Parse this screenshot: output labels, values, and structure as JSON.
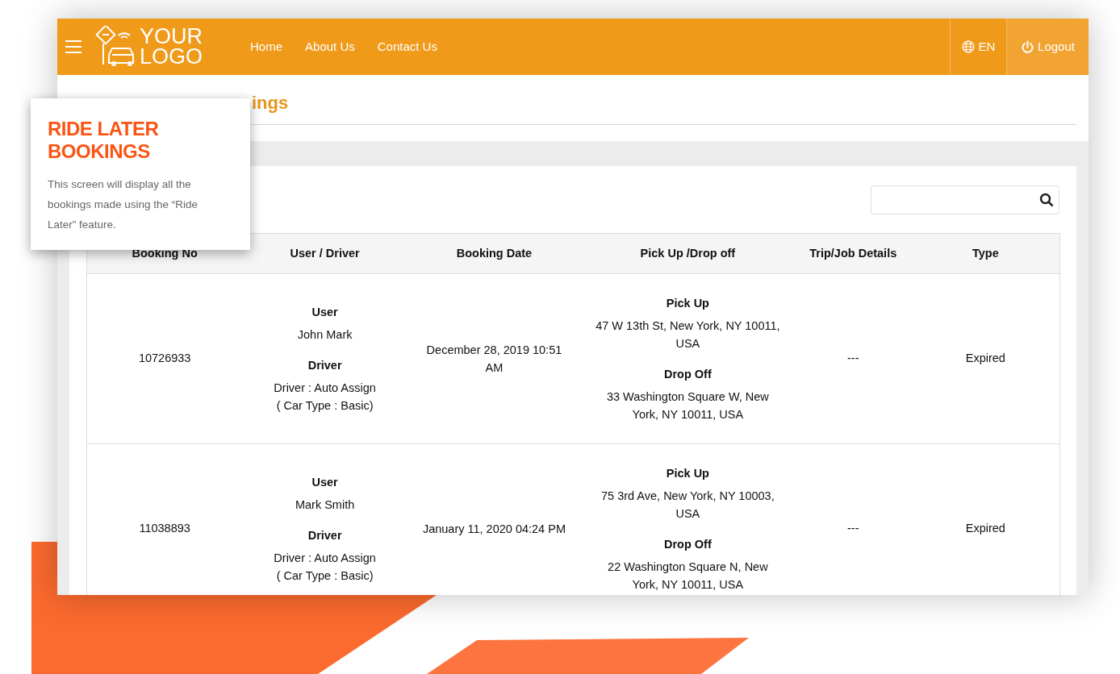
{
  "header": {
    "logo": {
      "line1": "YOUR",
      "line2": "LOGO"
    },
    "nav": [
      {
        "label": "Home"
      },
      {
        "label": "About Us"
      },
      {
        "label": "Contact Us"
      }
    ],
    "language": "EN",
    "logout": "Logout"
  },
  "page_title": "ings",
  "table": {
    "columns": [
      "Booking No",
      "User / Driver",
      "Booking Date",
      "Pick Up /Drop off",
      "Trip/Job Details",
      "Type"
    ],
    "rows": [
      {
        "booking_no": "10726933",
        "user_label": "User",
        "user": "John Mark",
        "driver_label": "Driver",
        "driver": "Driver : Auto Assign",
        "car_type": "( Car Type : Basic)",
        "date": "December 28, 2019 10:51 AM",
        "pickup_label": "Pick Up",
        "pickup": "47 W 13th St, New York, NY 10011, USA",
        "dropoff_label": "Drop Off",
        "dropoff": "33 Washington Square W, New York, NY 10011, USA",
        "details": "---",
        "type": "Expired"
      },
      {
        "booking_no": "11038893",
        "user_label": "User",
        "user": "Mark Smith",
        "driver_label": "Driver",
        "driver": "Driver : Auto Assign",
        "car_type": "( Car Type : Basic)",
        "date": "January 11, 2020 04:24 PM",
        "pickup_label": "Pick Up",
        "pickup": "75 3rd Ave, New York, NY 10003, USA",
        "dropoff_label": "Drop Off",
        "dropoff": "22 Washington Square N, New York, NY 10011, USA",
        "details": "---",
        "type": "Expired"
      }
    ]
  },
  "callout": {
    "title": "RIDE LATER BOOKINGS",
    "text": "This screen will display all the bookings made using the “Ride Later” feature."
  }
}
